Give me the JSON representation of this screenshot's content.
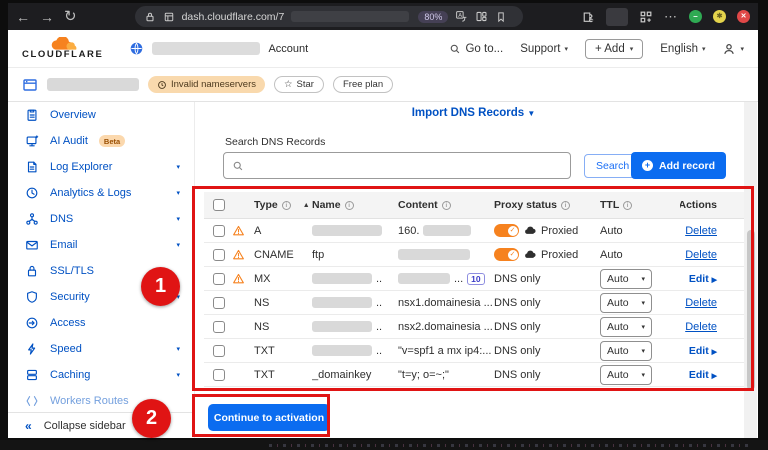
{
  "browser": {
    "url": "dash.cloudflare.com/7",
    "zoom_level": "80%"
  },
  "header": {
    "brand": "CLOUDFLARE",
    "account_label": "Account",
    "goto": "Go to...",
    "support": "Support",
    "add": "+ Add",
    "language": "English"
  },
  "subheader": {
    "nameserver_badge": "Invalid nameservers",
    "star": "Star",
    "plan": "Free plan"
  },
  "sidebar": {
    "items": [
      {
        "label": "Overview",
        "icon": "overview"
      },
      {
        "label": "AI Audit",
        "icon": "ai-audit",
        "badge": "Beta"
      },
      {
        "label": "Log Explorer",
        "icon": "log-explorer",
        "caret": true
      },
      {
        "label": "Analytics & Logs",
        "icon": "analytics",
        "caret": true
      },
      {
        "label": "DNS",
        "icon": "dns",
        "caret": true
      },
      {
        "label": "Email",
        "icon": "email",
        "caret": true
      },
      {
        "label": "SSL/TLS",
        "icon": "ssl"
      },
      {
        "label": "Security",
        "icon": "security",
        "caret": true
      },
      {
        "label": "Access",
        "icon": "access"
      },
      {
        "label": "Speed",
        "icon": "speed",
        "caret": true
      },
      {
        "label": "Caching",
        "icon": "caching",
        "caret": true
      },
      {
        "label": "Workers Routes",
        "icon": "workers",
        "faded": true
      }
    ],
    "collapse": "Collapse sidebar"
  },
  "main": {
    "import_link": "Import DNS Records",
    "search_label": "Search DNS Records",
    "search_button": "Search",
    "add_record_button": "Add record",
    "continue_button": "Continue to activation",
    "table": {
      "headers": [
        "Type",
        "Name",
        "Content",
        "Proxy status",
        "TTL",
        "Actions"
      ],
      "rows": [
        {
          "type": "A",
          "warning": true,
          "name": "",
          "name_blurred": true,
          "content_prefix": "160.",
          "content_blurred": true,
          "content": "",
          "proxy": "Proxied",
          "proxied": true,
          "ttl": "Auto",
          "ttl_dropdown": false,
          "action": "Delete"
        },
        {
          "type": "CNAME",
          "warning": true,
          "name": "ftp",
          "name_blurred": false,
          "content_blurred": true,
          "content": "",
          "proxy": "Proxied",
          "proxied": true,
          "ttl": "Auto",
          "ttl_dropdown": false,
          "action": "Delete"
        },
        {
          "type": "MX",
          "warning": true,
          "name": "",
          "name_blurred": true,
          "name_suffix": "..",
          "content_blurred": true,
          "content_suffix": "...",
          "priority": "10",
          "content": "",
          "proxy": "DNS only",
          "proxied": false,
          "ttl": "Auto",
          "ttl_dropdown": true,
          "action": "Edit"
        },
        {
          "type": "NS",
          "warning": false,
          "name": "",
          "name_blurred": true,
          "name_suffix": "..",
          "content": "nsx1.domainesia ...",
          "proxy": "DNS only",
          "proxied": false,
          "ttl": "Auto",
          "ttl_dropdown": true,
          "action": "Delete"
        },
        {
          "type": "NS",
          "warning": false,
          "name": "",
          "name_blurred": true,
          "name_suffix": "..",
          "content": "nsx2.domainesia ...",
          "proxy": "DNS only",
          "proxied": false,
          "ttl": "Auto",
          "ttl_dropdown": true,
          "action": "Delete"
        },
        {
          "type": "TXT",
          "warning": false,
          "name": "",
          "name_blurred": true,
          "name_suffix": "..",
          "content": "\"v=spf1 a mx ip4:...",
          "proxy": "DNS only",
          "proxied": false,
          "ttl": "Auto",
          "ttl_dropdown": true,
          "action": "Edit"
        },
        {
          "type": "TXT",
          "warning": false,
          "name": "_domainkey",
          "name_blurred": false,
          "content": "\"t=y; o=~;\"",
          "proxy": "DNS only",
          "proxied": false,
          "ttl": "Auto",
          "ttl_dropdown": true,
          "action": "Edit"
        }
      ]
    }
  },
  "annotations": {
    "step1": "1",
    "step2": "2"
  },
  "colors": {
    "link_blue": "#0051c3",
    "primary_button": "#0b6cf0",
    "cloudflare_orange": "#f6821f",
    "annotation_red": "#e01414",
    "proxied_toggle": "#f6821f"
  }
}
